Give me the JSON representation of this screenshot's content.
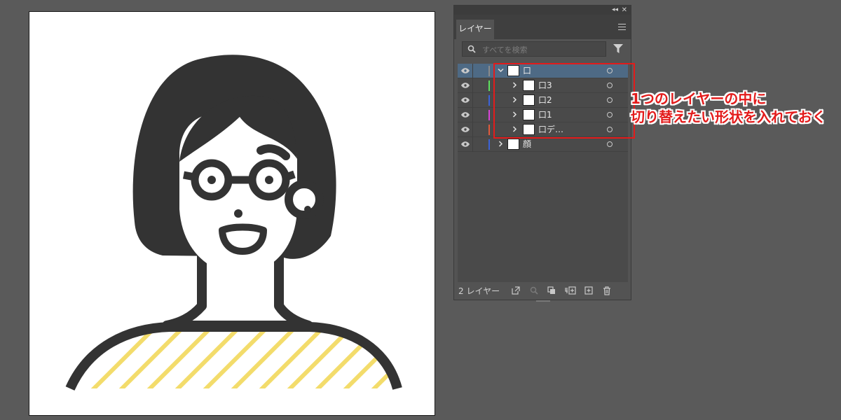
{
  "panel": {
    "tab_label": "レイヤー",
    "search_placeholder": "すべてを検索",
    "footer": {
      "layer_count": "2 レイヤー"
    },
    "layers": [
      {
        "label": "口",
        "color": "#8a8a8a",
        "expanded": true,
        "selected": true
      },
      {
        "label": "口3",
        "color": "#5ee05e"
      },
      {
        "label": "口2",
        "color": "#3c63d8"
      },
      {
        "label": "口1",
        "color": "#d845d8"
      },
      {
        "label": "口デ…",
        "color": "#e05a3c"
      },
      {
        "label": "顔",
        "color": "#3c63d8"
      }
    ]
  },
  "annotation": {
    "line1": "1つのレイヤーの中に",
    "line2": "切り替えたい形状を入れておく",
    "color": "#e31b1b"
  },
  "illustration": {
    "hair_color": "#333333",
    "stripe_color": "#f3dc6b"
  }
}
